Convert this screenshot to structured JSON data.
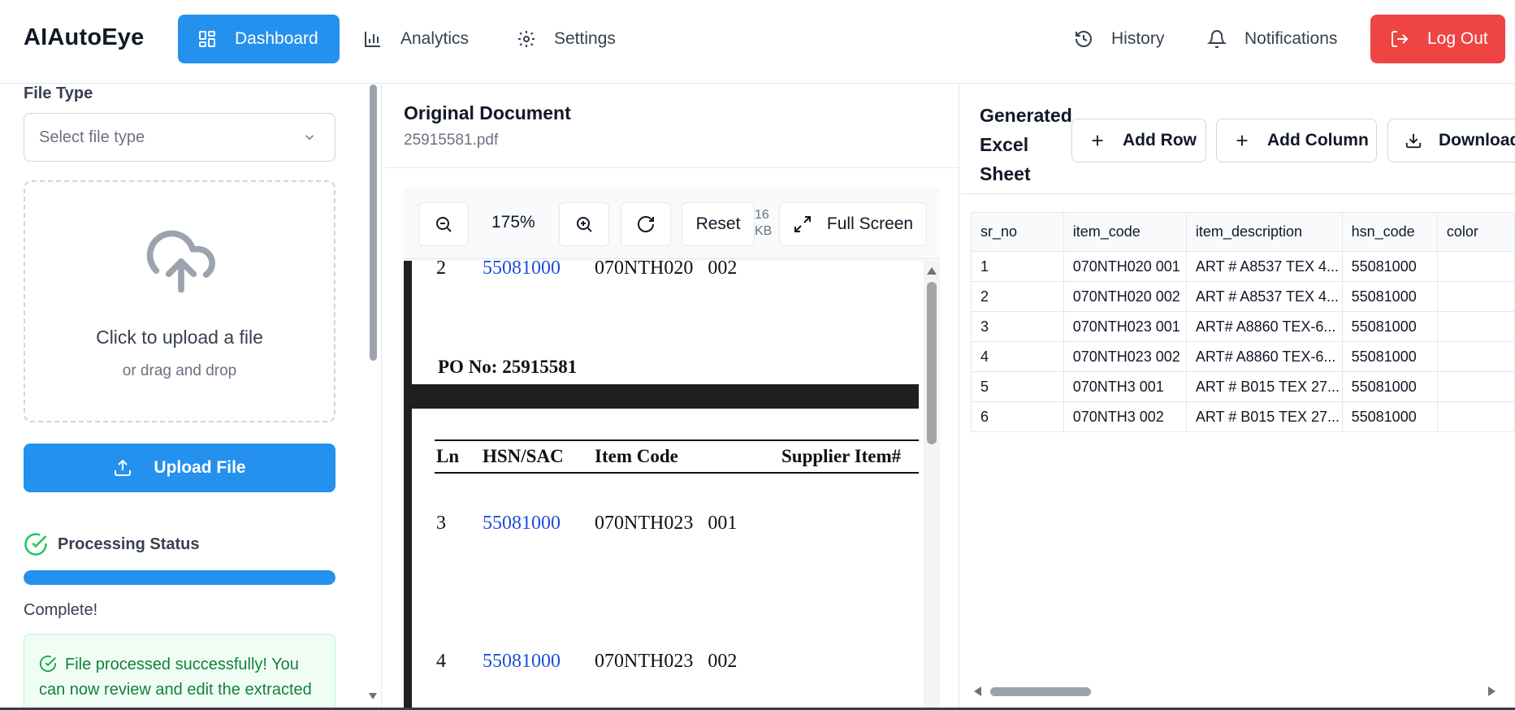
{
  "app": {
    "brand": "AIAutoEye"
  },
  "nav": {
    "dashboard": "Dashboard",
    "analytics": "Analytics",
    "settings": "Settings",
    "history": "History",
    "notifications": "Notifications",
    "logout": "Log Out"
  },
  "colors": {
    "primary": "#2491ee",
    "danger": "#ef4444",
    "success": "#22c55e"
  },
  "sidebar": {
    "file_type_label": "File Type",
    "file_type_placeholder": "Select file type",
    "dropzone_title": "Click to upload a file",
    "dropzone_sub": "or drag and drop",
    "upload_button": "Upload File",
    "status_title": "Processing Status",
    "progress_fraction": 1.0,
    "status_text": "Complete!",
    "success_message": "File processed successfully! You can now review and edit the extracted data."
  },
  "document": {
    "title": "Original Document",
    "filename": "25915581.pdf",
    "zoom": "175%",
    "reset": "Reset",
    "file_size": "16 KB",
    "full_screen": "Full Screen",
    "page": {
      "row2": {
        "ln": "2",
        "hsn": "55081000",
        "code": "070NTH020   002"
      },
      "po": "PO No: 25915581",
      "headers": {
        "ln": "Ln",
        "hsn": "HSN/SAC",
        "code": "Item Code",
        "supplier": "Supplier Item#"
      },
      "row3": {
        "ln": "3",
        "hsn": "55081000",
        "code": "070NTH023   001"
      },
      "row4": {
        "ln": "4",
        "hsn": "55081000",
        "code": "070NTH023   002"
      }
    }
  },
  "excel": {
    "title": "Generated Excel Sheet",
    "add_row": "Add Row",
    "add_column": "Add Column",
    "download": "Download",
    "columns": [
      "sr_no",
      "item_code",
      "item_description",
      "hsn_code",
      "color"
    ],
    "rows": [
      [
        "1",
        "070NTH020 001",
        "ART # A8537 TEX 4...",
        "55081000",
        ""
      ],
      [
        "2",
        "070NTH020 002",
        "ART # A8537 TEX 4...",
        "55081000",
        ""
      ],
      [
        "3",
        "070NTH023 001",
        "ART# A8860 TEX-6...",
        "55081000",
        ""
      ],
      [
        "4",
        "070NTH023 002",
        "ART# A8860 TEX-6...",
        "55081000",
        ""
      ],
      [
        "5",
        "070NTH3 001",
        "ART # B015 TEX 27...",
        "55081000",
        ""
      ],
      [
        "6",
        "070NTH3 002",
        "ART # B015 TEX 27...",
        "55081000",
        ""
      ]
    ]
  }
}
